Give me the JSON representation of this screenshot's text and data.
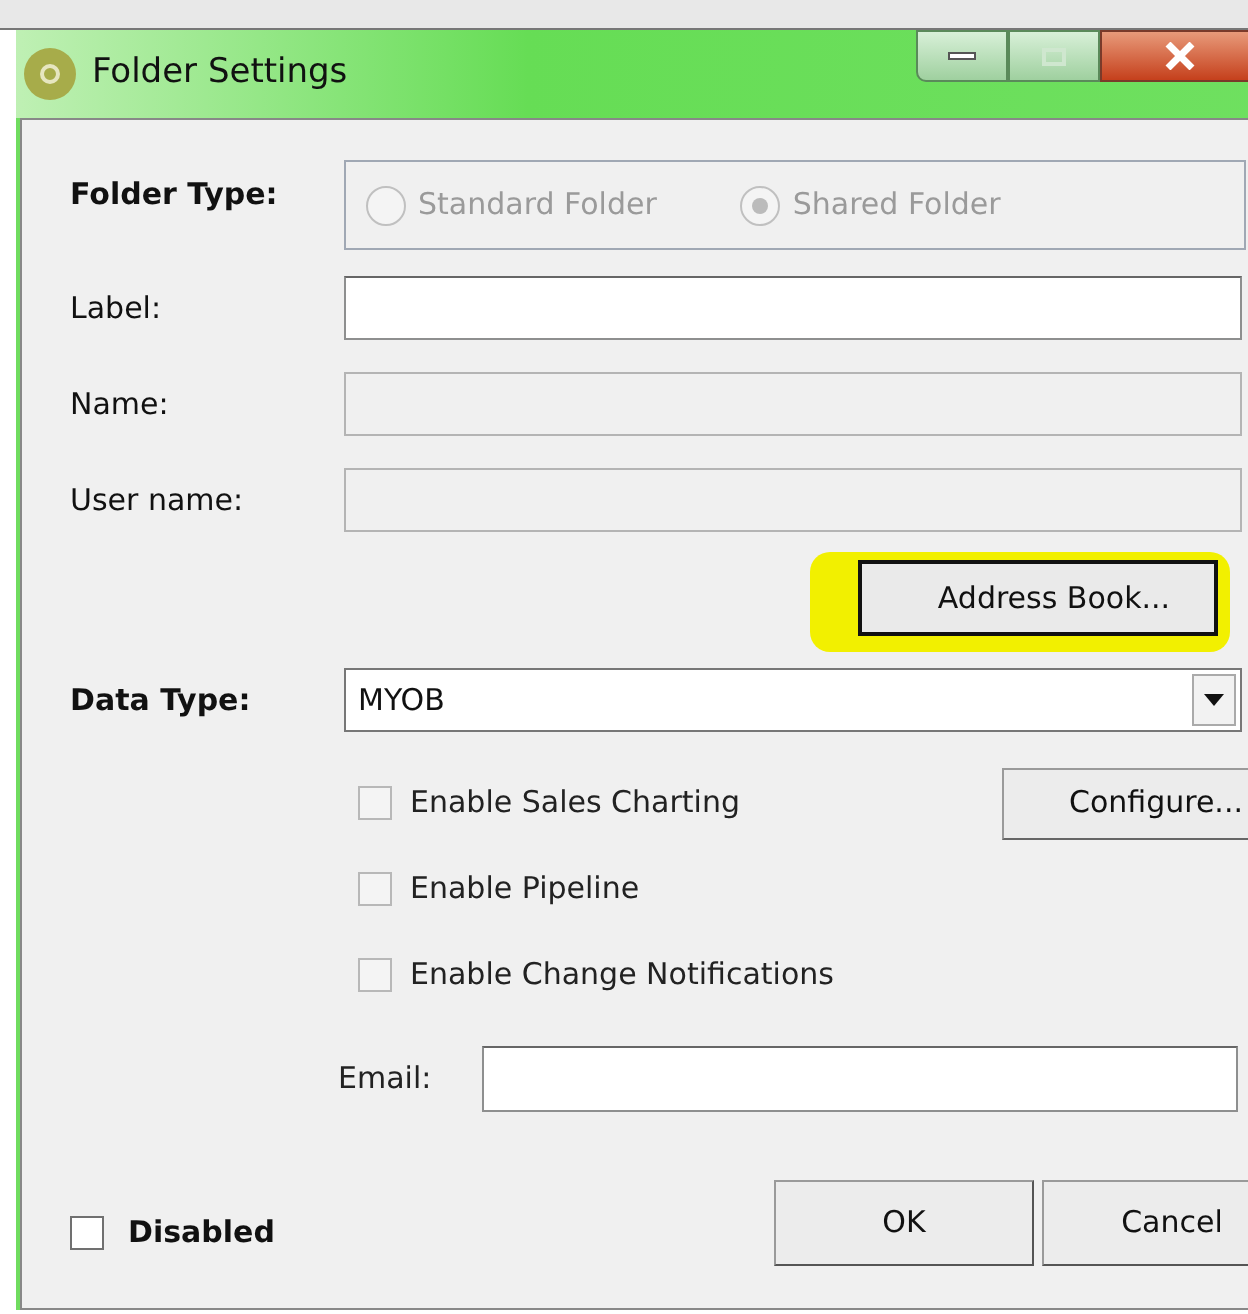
{
  "window": {
    "title": "Folder Settings"
  },
  "folder_type": {
    "label": "Folder Type:",
    "options": [
      {
        "label": "Standard Folder",
        "selected": false,
        "disabled": true
      },
      {
        "label": "Shared Folder",
        "selected": true,
        "disabled": true
      }
    ]
  },
  "fields": [
    {
      "label": "Label:",
      "disabled": false
    },
    {
      "label": "Name:",
      "disabled": true
    },
    {
      "label": "User name:",
      "disabled": true
    }
  ],
  "address_book_button": {
    "label": "Address Book...",
    "highlighted": true
  },
  "data_type": {
    "label": "Data Type:",
    "value": "MYOB"
  },
  "options": [
    {
      "label": "Enable Sales Charting",
      "checked": false,
      "disabled": true
    },
    {
      "label": "Enable Pipeline",
      "checked": false,
      "disabled": true
    },
    {
      "label": "Enable Change Notifications",
      "checked": false,
      "disabled": true
    }
  ],
  "configure_button": {
    "label": "Configure..."
  },
  "email": {
    "label": "Email:"
  },
  "disabled_checkbox": {
    "label": "Disabled",
    "checked": false
  },
  "buttons": [
    "OK",
    "Cancel"
  ]
}
